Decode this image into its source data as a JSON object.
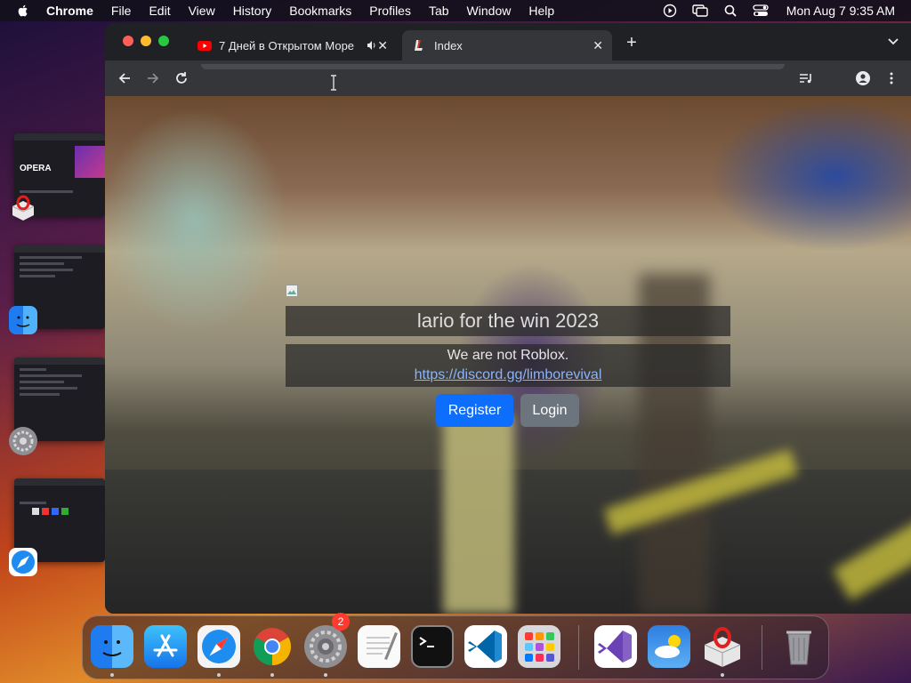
{
  "menubar": {
    "app_name": "Chrome",
    "items": [
      "File",
      "Edit",
      "View",
      "History",
      "Bookmarks",
      "Profiles",
      "Tab",
      "Window",
      "Help"
    ],
    "clock": "Mon Aug 7  9:35 AM"
  },
  "stage": {
    "opera_thumb_title": "OPERA"
  },
  "browser": {
    "tabs": [
      {
        "title": "7 Дней в Открытом Море",
        "favicon": "youtube-icon"
      },
      {
        "title": "Index",
        "favicon": "site-logo-icon"
      }
    ]
  },
  "page": {
    "title": "lario for the win 2023",
    "subtitle": "We are not Roblox.",
    "link": "https://discord.gg/limborevival",
    "register_label": "Register",
    "login_label": "Login"
  },
  "dock": {
    "settings_badge": "2",
    "apps": [
      "finder-icon",
      "app-store-icon",
      "safari-icon",
      "chrome-icon",
      "system-settings-icon",
      "textedit-icon",
      "terminal-icon",
      "vscode-icon",
      "launchpad-icon",
      "visual-studio-icon",
      "weather-icon",
      "opera-installer-icon",
      "trash-icon"
    ]
  },
  "colors": {
    "register_button": "#0d6efd",
    "login_button": "#6c757d",
    "link": "#8ab4f8"
  }
}
